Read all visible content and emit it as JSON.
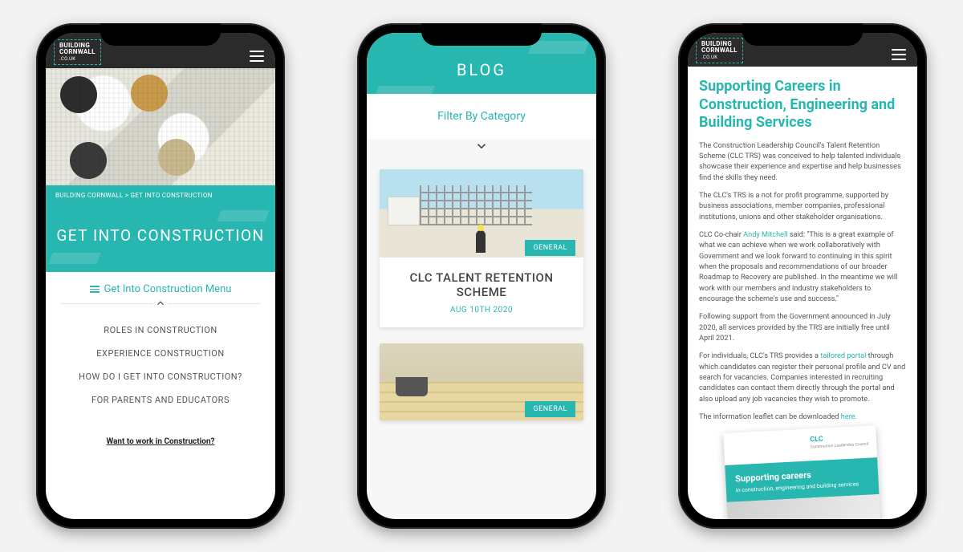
{
  "brand": {
    "line1": "BUILDING",
    "line2": "CORNWALL",
    "sub": ".CO.UK"
  },
  "phone1": {
    "breadcrumb": "BUILDING CORNWALL > GET INTO CONSTRUCTION",
    "title": "GET INTO CONSTRUCTION",
    "menu_toggle": "Get Into Construction Menu",
    "menu": [
      "ROLES IN CONSTRUCTION",
      "EXPERIENCE CONSTRUCTION",
      "HOW DO I GET INTO CONSTRUCTION?",
      "FOR PARENTS AND EDUCATORS"
    ],
    "cta": "Want to work in Construction?"
  },
  "phone2": {
    "title": "BLOG",
    "filter": "Filter By Category",
    "card1": {
      "tag": "GENERAL",
      "title": "CLC TALENT RETENTION SCHEME",
      "date": "AUG 10TH 2020"
    },
    "card2": {
      "tag": "GENERAL"
    }
  },
  "phone3": {
    "heading": "Supporting Careers in Construction, Engineering and Building Services",
    "p1": "The Construction Leadership Council's Talent Retention Scheme (CLC TRS) was conceived to help talented individuals showcase their experience and expertise and help businesses find the skills they need.",
    "p2": "The CLC's TRS is a not for profit programme, supported by business associations, member companies, professional institutions, unions and other stakeholder organisations.",
    "p3a": "CLC Co-chair ",
    "p3link": "Andy Mitchell",
    "p3b": " said: \"This is a great example of what we can achieve when we work collaboratively with Government and we look forward to continuing in this spirit when the proposals and recommendations of our broader Roadmap to Recovery are published. In the meantime we will work with our members and industry stakeholders to encourage the scheme's use and success.\"",
    "p4": "Following support from the Government announced in July 2020, all services provided by the TRS are initially free until April 2021.",
    "p5a": "For individuals, CLC's TRS provides a ",
    "p5link": "tailored portal",
    "p5b": " through which candidates can register their personal profile and CV and search for vacancies. Companies interested in recruiting candidates can contact them directly through the portal and also upload any job vacancies they wish to promote.",
    "p6a": "The information leaflet can be downloaded ",
    "p6link": "here.",
    "leaflet": {
      "logo": "CLC",
      "logosub": "Construction Leadership Council",
      "title": "Supporting careers",
      "sub": "in construction, engineering and building services"
    }
  }
}
